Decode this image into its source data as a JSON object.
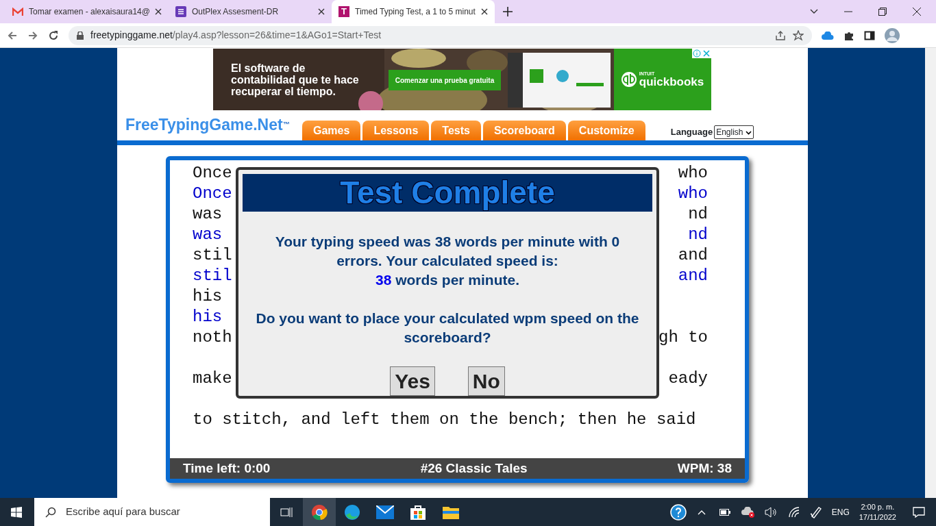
{
  "browser": {
    "tabs": [
      {
        "title": "Tomar examen - alexaisaura14@",
        "kind": "mail",
        "selected": false
      },
      {
        "title": "OutPlex Assesment-DR",
        "kind": "form",
        "selected": false
      },
      {
        "title": "Timed Typing Test, a 1 to 5 minut",
        "kind": "letter",
        "selected": true
      }
    ],
    "favicon_letter": "T",
    "url": {
      "host": "freetypinggame.net",
      "path": "/play4.asp?lesson=26&time=1&AGo1=Start+Test"
    }
  },
  "ad": {
    "headline": "El software de contabilidad que te hace recuperar el tiempo.",
    "cta": "Comenzar una prueba gratuita",
    "brand_small": "INTUIT",
    "brand": "quickbooks"
  },
  "site": {
    "logo": "FreeTypingGame.Net",
    "trademark": "™",
    "nav": [
      {
        "label": "Games"
      },
      {
        "label": "Lessons"
      },
      {
        "label": "Tests"
      },
      {
        "label": "Scoreboard"
      },
      {
        "label": "Customize"
      }
    ],
    "language_label": "Language",
    "language_value": "English"
  },
  "typing": {
    "lines": [
      {
        "kind": "source",
        "left": "Once",
        "right": "who"
      },
      {
        "kind": "typed",
        "left": "Once",
        "right": "who"
      },
      {
        "kind": "source",
        "left": "was",
        "right": "nd"
      },
      {
        "kind": "typed",
        "left": "was",
        "right": "nd"
      },
      {
        "kind": "source",
        "left": "stil",
        "right": "and"
      },
      {
        "kind": "typed",
        "left": "stil",
        "right": "and"
      },
      {
        "kind": "source",
        "left": "his"
      },
      {
        "kind": "typed",
        "left": "his"
      },
      {
        "kind": "source",
        "left": "noth",
        "right": "gh to"
      },
      {
        "kind": "blank"
      },
      {
        "kind": "source",
        "left": "make",
        "right": "eady"
      },
      {
        "kind": "blank"
      },
      {
        "kind": "source",
        "left": "to stitch, and left them on the bench; then he said"
      }
    ],
    "status": {
      "time_left": "Time left: 0:00",
      "lesson": "#26 Classic Tales",
      "wpm": "WPM: 38"
    }
  },
  "dialog": {
    "title": "Test Complete",
    "message": "Your typing speed was 38 words per minute with 0 errors. Your calculated speed is:",
    "speed_value": "38",
    "speed_unit": "words per minute.",
    "question": "Do you want to place your calculated wpm speed on the scoreboard?",
    "buttons": [
      "Yes",
      "No"
    ]
  },
  "taskbar": {
    "search_placeholder": "Escribe aquí para buscar",
    "language": "ENG",
    "time": "2:00 p. m.",
    "date": "17/11/2022"
  }
}
